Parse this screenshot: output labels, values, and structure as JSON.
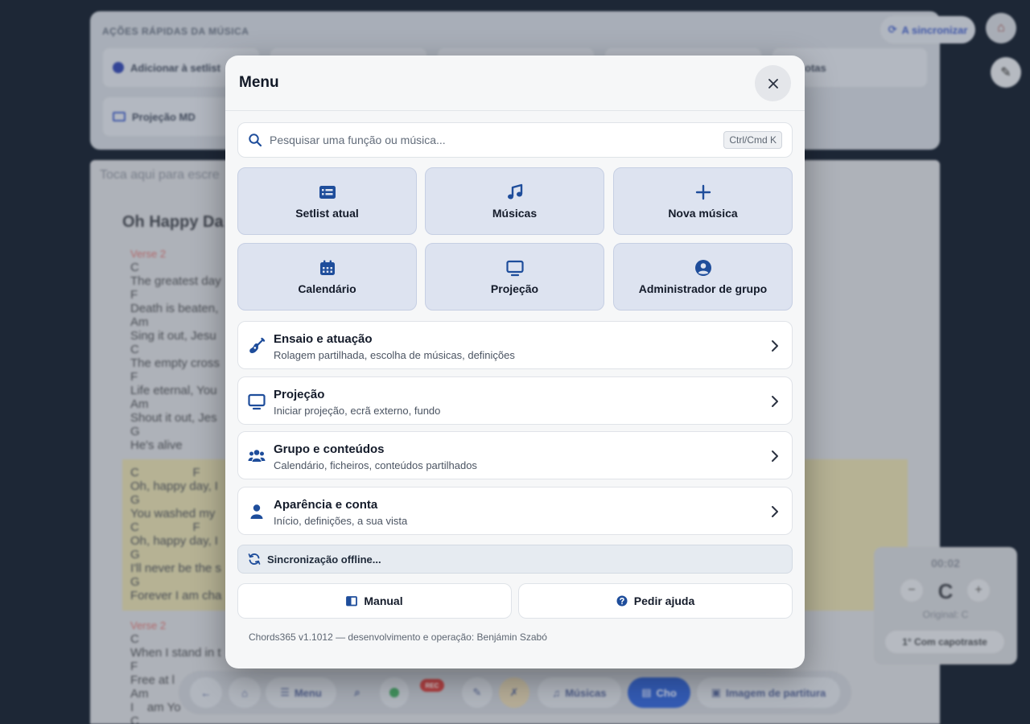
{
  "background": {
    "quick_actions_title": "AÇÕES RÁPIDAS DA MÚSICA",
    "quick_actions": [
      "Adicionar à setlist",
      "Projeção MD"
    ],
    "quick_actions_right": "otas",
    "sync_pill": "A sincronizar",
    "hint": "Toca aqui para escre",
    "song_title": "Oh Happy Da",
    "verse_label": "Verse 2",
    "verse_lines": [
      "C",
      "The greatest day",
      "F",
      "Death is beaten,",
      "Am",
      "Sing it out, Jesu",
      "C",
      "The empty cross",
      "F",
      "Life eternal, You",
      "Am",
      "Shout it out, Jes",
      "G",
      "He's alive"
    ],
    "chorus_lines": [
      "C                F",
      "Oh, happy day, I",
      "G",
      "You washed my",
      "C                F",
      "Oh, happy day, I",
      "G",
      "I'll never be the s",
      "G",
      "Forever I am cha"
    ],
    "verse2_label": "Verse 2",
    "verse2_lines": [
      "C",
      "When I stand in t",
      "F",
      "Free at l",
      "Am",
      "I    am Yo",
      "C"
    ],
    "transpose": {
      "time": "00:02",
      "key": "C",
      "original": "Original: C",
      "capo": "Com capotraste",
      "capo_num": "1°"
    },
    "toolbar": {
      "menu": "Menu",
      "musicas": "Músicas",
      "cho": "Cho",
      "score": "Imagem de partitura",
      "badge": "REC"
    }
  },
  "modal": {
    "title": "Menu",
    "search": {
      "placeholder": "Pesquisar uma função ou música...",
      "shortcut": "Ctrl/Cmd K"
    },
    "tiles": [
      {
        "label": "Setlist atual",
        "icon": "list-icon"
      },
      {
        "label": "Músicas",
        "icon": "music-note-icon"
      },
      {
        "label": "Nova música",
        "icon": "plus-icon"
      },
      {
        "label": "Calendário",
        "icon": "calendar-icon"
      },
      {
        "label": "Projeção",
        "icon": "monitor-icon"
      },
      {
        "label": "Administrador de grupo",
        "icon": "user-circle-icon"
      }
    ],
    "rows": [
      {
        "title": "Ensaio e atuação",
        "subtitle": "Rolagem partilhada, escolha de músicas, definições",
        "icon": "guitar-icon"
      },
      {
        "title": "Projeção",
        "subtitle": "Iniciar projeção, ecrã externo, fundo",
        "icon": "monitor-icon"
      },
      {
        "title": "Grupo e conteúdos",
        "subtitle": "Calendário, ficheiros, conteúdos partilhados",
        "icon": "users-icon"
      },
      {
        "title": "Aparência e conta",
        "subtitle": "Início, definições, a sua vista",
        "icon": "user-icon"
      }
    ],
    "sync": "Sincronização offline...",
    "manual": "Manual",
    "help": "Pedir ajuda",
    "version": "Chords365 v1.1012 — desenvolvimento e operação: Benjámin Szabó"
  },
  "colors": {
    "accent": "#1e4d9b",
    "tile_bg": "#dde3f0",
    "modal_bg": "#f6f7f8"
  }
}
